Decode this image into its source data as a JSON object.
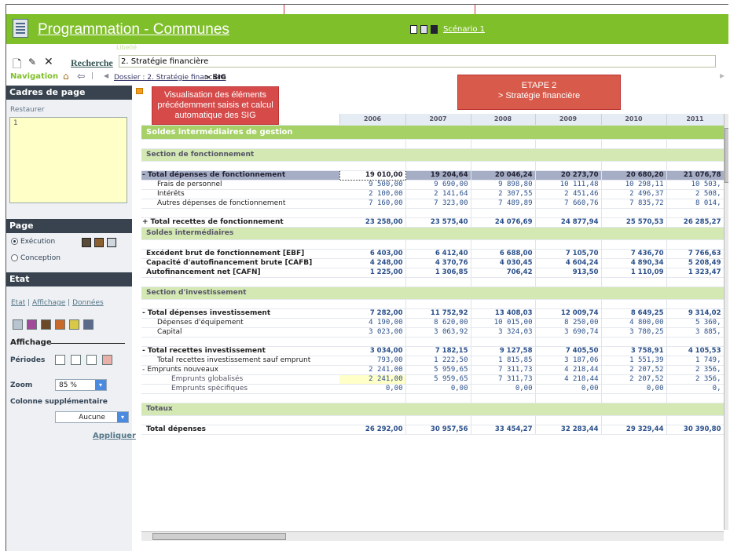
{
  "app": {
    "title": "Programmation - Communes",
    "scenario": "Scénario 1"
  },
  "header": {
    "libelle_label": "Libellé",
    "recherche_label": "Recherche",
    "libelle_value": "2. Stratégie financière"
  },
  "navigation": {
    "label": "Navigation",
    "crumb_link": "Dossier : 2. Stratégie financière",
    "crumb_current": "> SIG"
  },
  "left": {
    "cadres_title": "Cadres de page",
    "restaurer": "Restaurer",
    "cadres_value": "1",
    "page_title": "Page",
    "execution": "Exécution",
    "conception": "Conception",
    "etat_title": "Etat",
    "etat_link": "Etat",
    "affichage_link": "Affichage",
    "donnees_link": "Données",
    "affichage_heading": "Affichage",
    "periodes_label": "Périodes",
    "zoom_label": "Zoom",
    "zoom_value": "85 %",
    "colonne_label": "Colonne supplémentaire",
    "colonne_value": "Aucune",
    "appliquer": "Appliquer"
  },
  "callouts": {
    "left": "Visualisation des éléments précédemment saisis et calcul automatique des SIG",
    "right": "ETAPE 2\n> Stratégie financière"
  },
  "grid": {
    "years": [
      "2006",
      "2007",
      "2008",
      "2009",
      "2010",
      "2011"
    ],
    "rows": [
      {
        "kind": "g1",
        "label": "Soldes intermédiaires de gestion",
        "values": []
      },
      {
        "kind": "blank",
        "label": "",
        "values": []
      },
      {
        "kind": "g2",
        "label": "Section de fonctionnement",
        "values": []
      },
      {
        "kind": "blank",
        "label": "",
        "values": []
      },
      {
        "kind": "sum",
        "prefix": "-",
        "label": "Total dépenses de fonctionnement",
        "values": [
          "19 010,00",
          "19 204,64",
          "20 046,24",
          "20 273,70",
          "20 680,20",
          "21 076,78"
        ]
      },
      {
        "kind": "sub",
        "label": "Frais de personnel",
        "values": [
          "9 500,00",
          "9 690,00",
          "9 898,80",
          "10 111,48",
          "10 298,11",
          "10 503,"
        ]
      },
      {
        "kind": "sub",
        "label": "Intérêts",
        "values": [
          "2 100,00",
          "2 141,64",
          "2 307,55",
          "2 451,46",
          "2 496,37",
          "2 508,"
        ]
      },
      {
        "kind": "sub",
        "label": "Autres dépenses de fonctionnement",
        "values": [
          "7 160,00",
          "7 323,00",
          "7 489,89",
          "7 660,76",
          "7 835,72",
          "8 014,"
        ]
      },
      {
        "kind": "blank",
        "label": "",
        "values": []
      },
      {
        "kind": "bold",
        "prefix": "+",
        "label": "Total recettes de fonctionnement",
        "values": [
          "23 258,00",
          "23 575,40",
          "24 076,69",
          "24 877,94",
          "25 570,53",
          "26 285,27"
        ]
      },
      {
        "kind": "g2",
        "label": "Soldes intermédiaires",
        "values": []
      },
      {
        "kind": "blank",
        "label": "",
        "values": []
      },
      {
        "kind": "bold",
        "label": "Excédent brut de fonctionnement [EBF]",
        "values": [
          "6 403,00",
          "6 412,40",
          "6 688,00",
          "7 105,70",
          "7 436,70",
          "7 766,63"
        ]
      },
      {
        "kind": "bold",
        "label": "Capacité d'autofinancement brute [CAFB]",
        "values": [
          "4 248,00",
          "4 370,76",
          "4 030,45",
          "4 604,24",
          "4 890,34",
          "5 208,49"
        ]
      },
      {
        "kind": "bold",
        "label": "Autofinancement net [CAFN]",
        "values": [
          "1 225,00",
          "1 306,85",
          "706,42",
          "913,50",
          "1 110,09",
          "1 323,47"
        ]
      },
      {
        "kind": "blank",
        "label": "",
        "values": []
      },
      {
        "kind": "g2",
        "label": "Section d'investissement",
        "values": []
      },
      {
        "kind": "blank",
        "label": "",
        "values": []
      },
      {
        "kind": "top",
        "prefix": "-",
        "label": "Total dépenses investissement",
        "values": [
          "7 282,00",
          "11 752,92",
          "13 408,03",
          "12 009,74",
          "8 649,25",
          "9 314,02"
        ]
      },
      {
        "kind": "sub",
        "label": "Dépenses d'équipement",
        "values": [
          "4 190,00",
          "8 620,00",
          "10 015,00",
          "8 250,00",
          "4 800,00",
          "5 360,"
        ]
      },
      {
        "kind": "sub",
        "label": "Capital",
        "values": [
          "3 023,00",
          "3 063,92",
          "3 324,03",
          "3 690,74",
          "3 780,25",
          "3 885,"
        ]
      },
      {
        "kind": "blank",
        "label": "",
        "values": []
      },
      {
        "kind": "top",
        "prefix": "-",
        "label": "Total recettes investissement",
        "values": [
          "3 034,00",
          "7 182,15",
          "9 127,58",
          "7 405,50",
          "3 758,91",
          "4 105,53"
        ]
      },
      {
        "kind": "sub",
        "label": "Total recettes investissement sauf emprunt",
        "values": [
          "793,00",
          "1 222,50",
          "1 815,85",
          "3 187,06",
          "1 551,39",
          "1 749,"
        ]
      },
      {
        "kind": "sub",
        "prefix": "-",
        "label": "Emprunts nouveaux",
        "values": [
          "2 241,00",
          "5 959,65",
          "7 311,73",
          "4 218,44",
          "2 207,52",
          "2 356,"
        ]
      },
      {
        "kind": "sub2",
        "label": "Emprunts globalisés",
        "values": [
          "2 241,00",
          "5 959,65",
          "7 311,73",
          "4 218,44",
          "2 207,52",
          "2 356,"
        ]
      },
      {
        "kind": "sub2",
        "label": "Emprunts spécifiques",
        "values": [
          "0,00",
          "0,00",
          "0,00",
          "0,00",
          "0,00",
          "0,"
        ]
      },
      {
        "kind": "blank",
        "label": "",
        "values": []
      },
      {
        "kind": "g2",
        "label": "Totaux",
        "values": []
      },
      {
        "kind": "blank",
        "label": "",
        "values": []
      },
      {
        "kind": "top",
        "label": "Total dépenses",
        "values": [
          "26 292,00",
          "30 957,56",
          "33 454,27",
          "32 283,44",
          "29 329,44",
          "30 390,80"
        ]
      }
    ]
  }
}
